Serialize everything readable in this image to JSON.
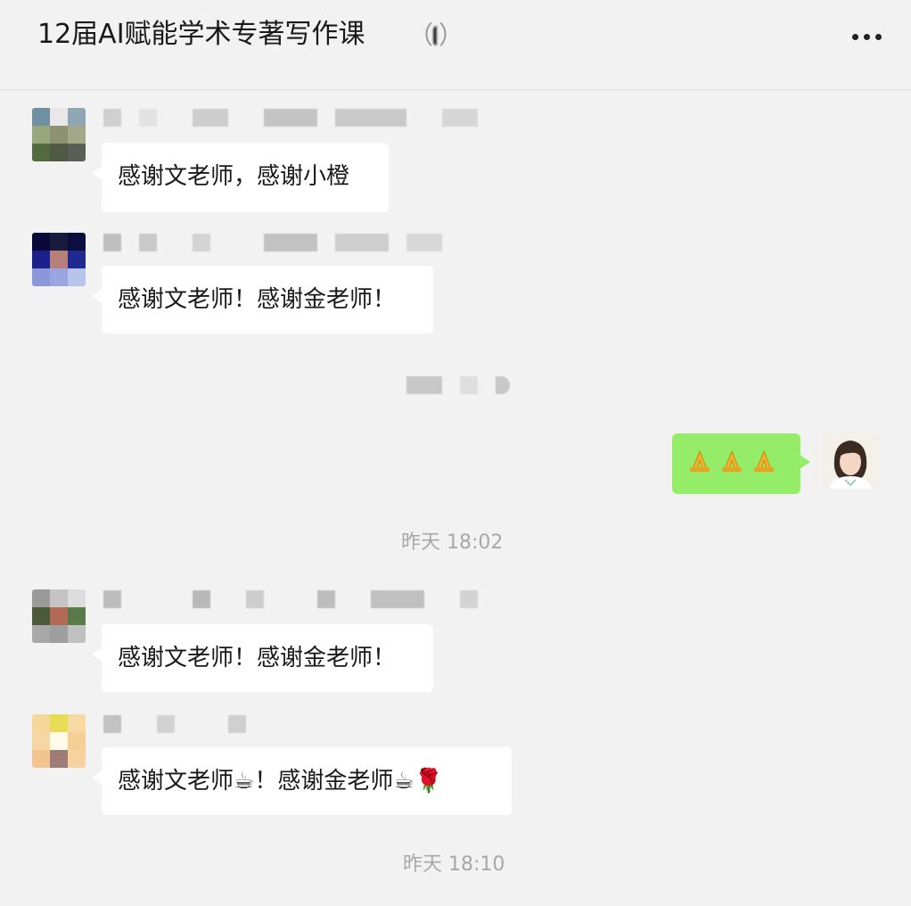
{
  "header": {
    "title": "12届AI赋能学术专著写作课",
    "suffix_paren_open": "（",
    "suffix_paren_close": "）",
    "more_icon": "ellipsis-icon"
  },
  "messages": [
    {
      "side": "left",
      "text": "感谢文老师，感谢小橙"
    },
    {
      "side": "left",
      "text": "感谢文老师！感谢金老师！"
    },
    {
      "side": "right",
      "icons": [
        "pray-icon",
        "pray-icon",
        "pray-icon"
      ]
    },
    {
      "side": "left",
      "text": "感谢文老师！感谢金老师！"
    },
    {
      "side": "left",
      "parts": [
        "感谢文老师",
        "☕",
        "！感谢金老师",
        "☕",
        "🌹"
      ]
    }
  ],
  "timestamps": [
    "昨天 18:02",
    "昨天 18:10"
  ],
  "colors": {
    "background": "#f2f2f2",
    "bubble_left": "#ffffff",
    "bubble_right": "#95ec69",
    "timestamp": "#a8a8a8"
  }
}
